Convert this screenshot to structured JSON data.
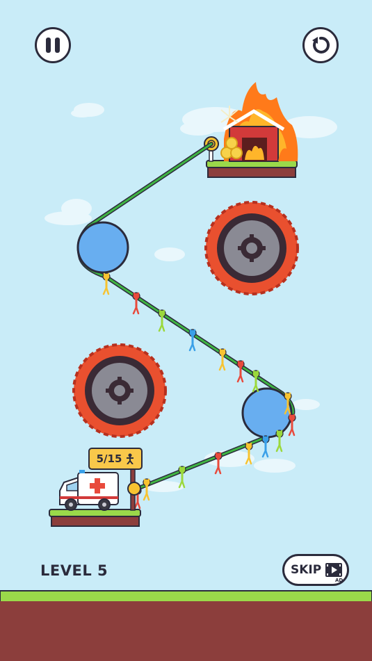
{
  "hud": {
    "pause_icon": "pause-icon",
    "restart_icon": "restart-icon",
    "level_label": "LEVEL 5",
    "skip_label": "SKIP",
    "skip_ad_label": "AD",
    "skip_icon": "video-ad-icon"
  },
  "counter": {
    "text": "5/15",
    "icon": "stickman-icon"
  },
  "colors": {
    "sky": "#c9ecf8",
    "grass": "#9ad94a",
    "dirt": "#8c3e3c",
    "rope": "#3fb543",
    "pulley": "#68aef0",
    "saw_red": "#e9502f",
    "saw_hub": "#8a8a94",
    "fire": "#ff7a1a",
    "barn": "#d23a3a",
    "sign": "#f9c84a"
  },
  "stickmen_colors": [
    "#f7c331",
    "#e84a3c",
    "#9bd83c",
    "#3aa0e8",
    "#f7c331",
    "#e84a3c",
    "#9bd83c"
  ]
}
